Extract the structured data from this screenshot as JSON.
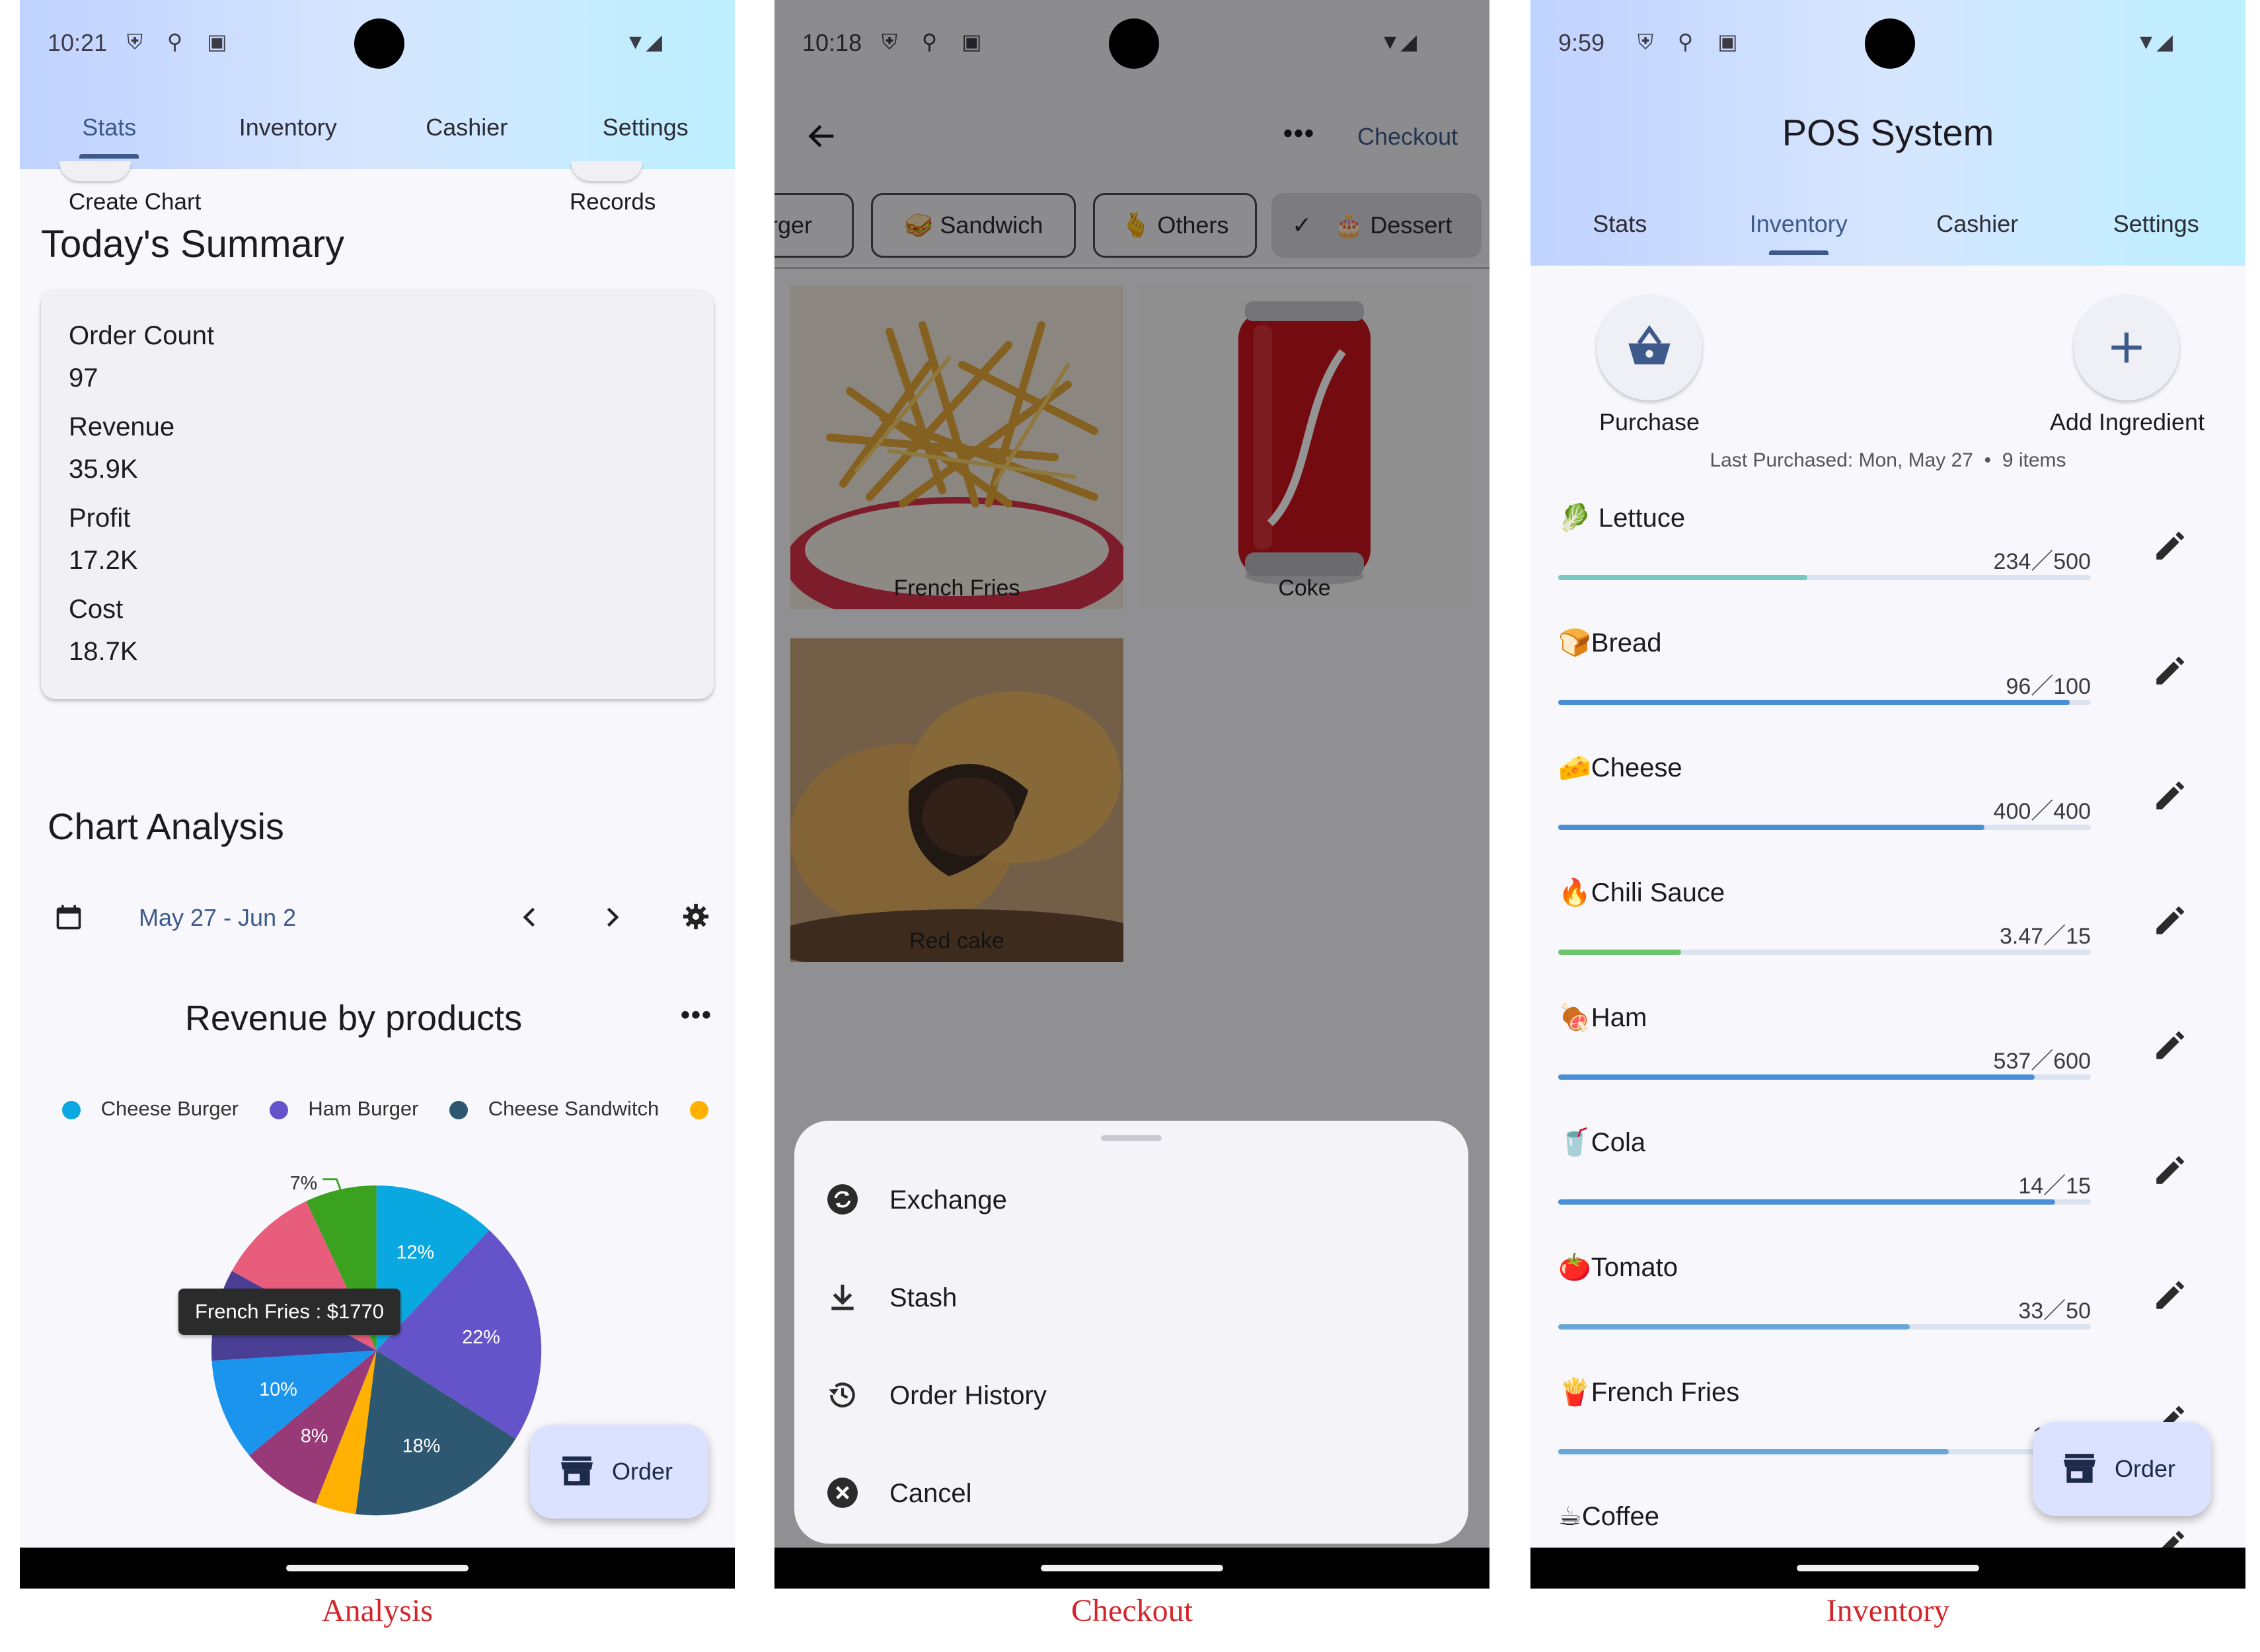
{
  "captions": {
    "analysis": "Analysis",
    "checkout": "Checkout",
    "inventory": "Inventory"
  },
  "analysis": {
    "status_time": "10:21",
    "tabs": [
      "Stats",
      "Inventory",
      "Cashier",
      "Settings"
    ],
    "active_tab": "Stats",
    "quick_actions": {
      "create_chart": "Create Chart",
      "records": "Records"
    },
    "summary_title": "Today's Summary",
    "metrics": [
      {
        "label": "Order Count",
        "value": "97"
      },
      {
        "label": "Revenue",
        "value": "35.9K"
      },
      {
        "label": "Profit",
        "value": "17.2K"
      },
      {
        "label": "Cost",
        "value": "18.7K"
      }
    ],
    "chart_section_title": "Chart Analysis",
    "date_range": "May 27 - Jun 2",
    "chart_title": "Revenue by products",
    "tooltip": "French Fries : $1770",
    "fab_label": "Order"
  },
  "chart_data": {
    "type": "pie",
    "title": "Revenue by products",
    "legend": [
      "Cheese Burger",
      "Ham Burger",
      "Cheese Sandwitch"
    ],
    "legend_colors": [
      "#0aa8e0",
      "#6554c9",
      "#2e5872",
      "#ffb000"
    ],
    "slices": [
      {
        "label": "12%",
        "value": 12,
        "color": "#0aa8e0"
      },
      {
        "label": "22%",
        "value": 22,
        "color": "#6554c9"
      },
      {
        "label": "18%",
        "value": 18,
        "color": "#2e5872"
      },
      {
        "label": "",
        "value": 4,
        "color": "#ffb000"
      },
      {
        "label": "8%",
        "value": 8,
        "color": "#983a78"
      },
      {
        "label": "10%",
        "value": 10,
        "color": "#1b94ee"
      },
      {
        "label": "9%",
        "value": 9,
        "color": "#4a3f95"
      },
      {
        "label": "",
        "value": 10,
        "color": "#e85c7c"
      },
      {
        "label": "7%",
        "value": 7,
        "color": "#3aa21f"
      }
    ]
  },
  "checkout": {
    "status_time": "10:18",
    "checkout_label": "Checkout",
    "chips": [
      {
        "label": "rger",
        "selected": false
      },
      {
        "label": "🥪 Sandwich",
        "selected": false
      },
      {
        "label": "🫰 Others",
        "selected": false
      },
      {
        "label": "🎂 Dessert",
        "selected": true
      }
    ],
    "products": [
      "French Fries",
      "Coke",
      "Red cake"
    ],
    "sheet_items": [
      "Exchange",
      "Stash",
      "Order History",
      "Cancel"
    ]
  },
  "inventory": {
    "status_time": "9:59",
    "app_title": "POS System",
    "tabs": [
      "Stats",
      "Inventory",
      "Cashier",
      "Settings"
    ],
    "active_tab": "Inventory",
    "purchase_label": "Purchase",
    "add_label": "Add Ingredient",
    "last_purchased": "Last Purchased: Mon, May 27  •  9 items",
    "items": [
      {
        "name": "🥬 Lettuce",
        "qty": "234／500",
        "fraction": 0.468,
        "color": "#7cc7c4"
      },
      {
        "name": "🍞Bread",
        "qty": "96／100",
        "fraction": 0.96,
        "color": "#4a8fd6"
      },
      {
        "name": "🧀Cheese",
        "qty": "400／400",
        "fraction": 0.8,
        "color": "#4a8fd6"
      },
      {
        "name": "🔥Chili Sauce",
        "qty": "3.47／15",
        "fraction": 0.231,
        "color": "#6cc46c"
      },
      {
        "name": "🍖Ham",
        "qty": "537／600",
        "fraction": 0.895,
        "color": "#4a8fd6"
      },
      {
        "name": "🥤Cola",
        "qty": "14／15",
        "fraction": 0.933,
        "color": "#4a8fd6"
      },
      {
        "name": "🍅Tomato",
        "qty": "33／50",
        "fraction": 0.66,
        "color": "#6aa7d8"
      },
      {
        "name": "🍟French Fries",
        "qty": "110／",
        "fraction": 0.733,
        "color": "#6aa7d8"
      },
      {
        "name": "☕Coffee",
        "qty": "",
        "fraction": 0,
        "color": "#6aa7d8"
      }
    ],
    "fab_label": "Order"
  }
}
